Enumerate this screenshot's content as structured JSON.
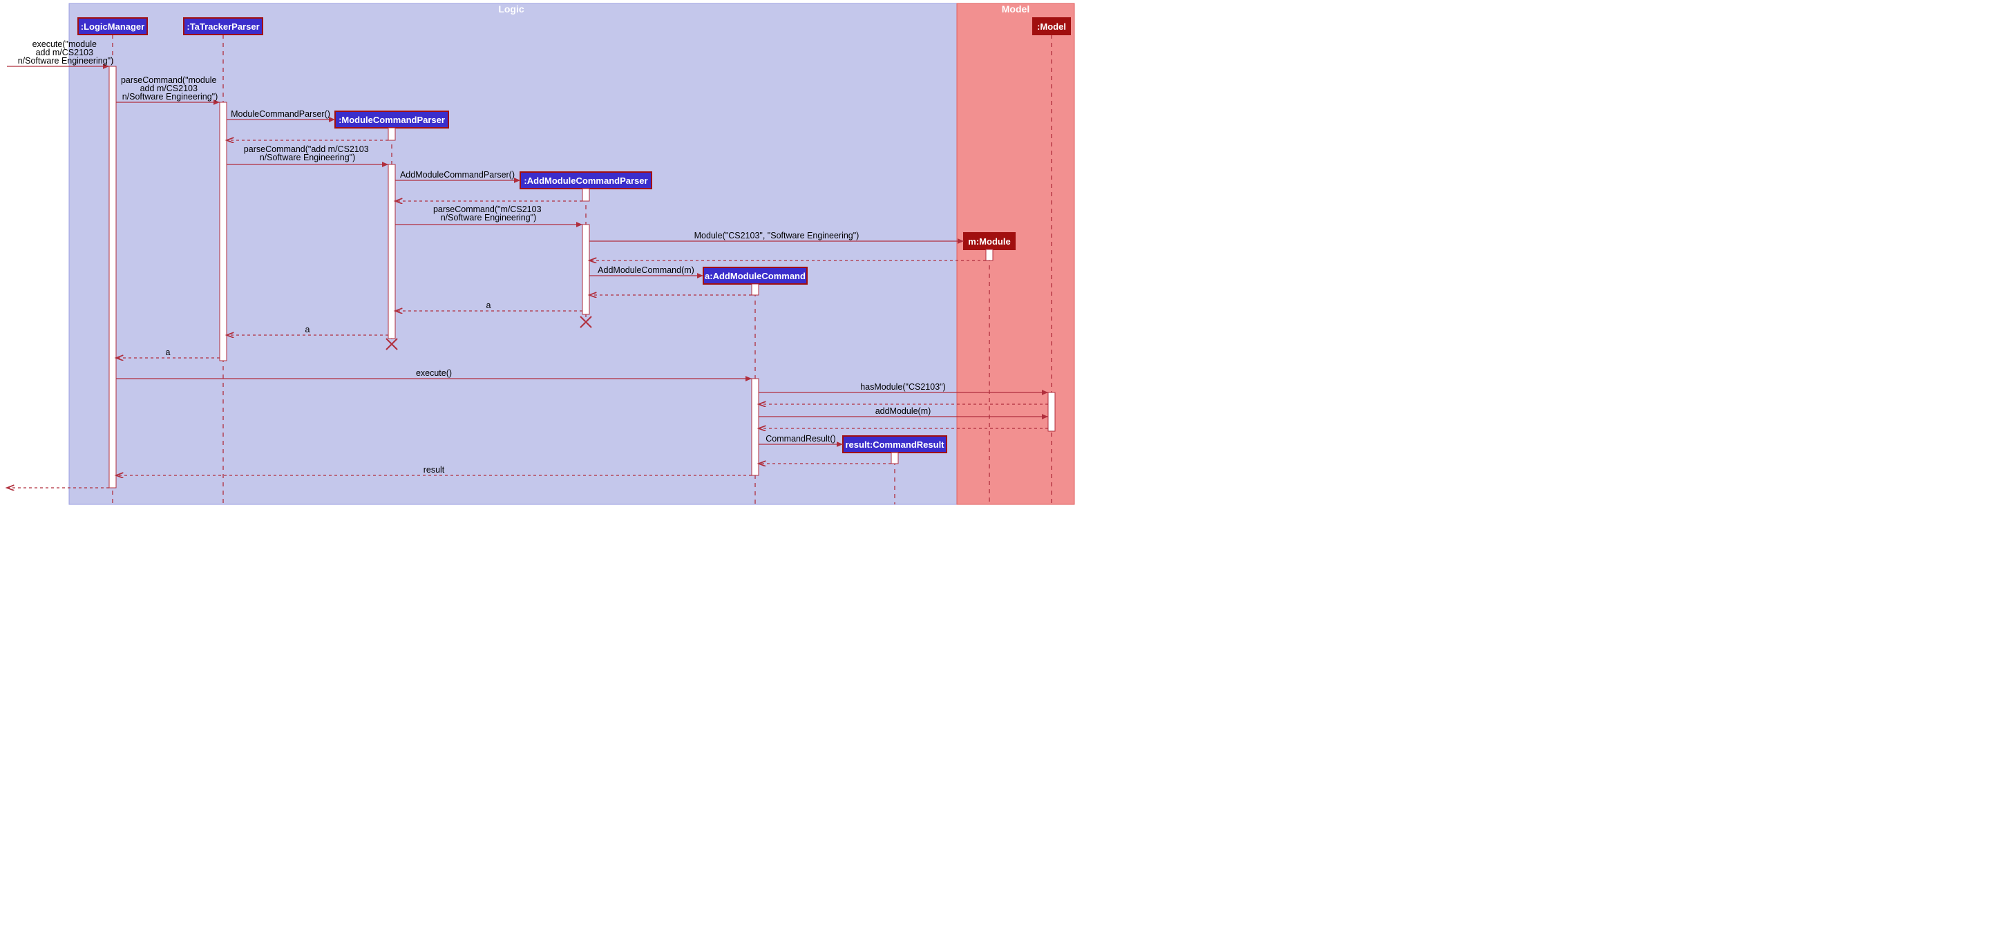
{
  "frames": {
    "logic": {
      "title": "Logic"
    },
    "model": {
      "title": "Model"
    }
  },
  "lifelines": [
    {
      "id": "lm",
      "label": ":LogicManager",
      "kind": "logic"
    },
    {
      "id": "ttp",
      "label": ":TaTrackerParser",
      "kind": "logic"
    },
    {
      "id": "mcp",
      "label": ":ModuleCommandParser",
      "kind": "logic"
    },
    {
      "id": "amcp",
      "label": ":AddModuleCommandParser",
      "kind": "logic"
    },
    {
      "id": "amc",
      "label": "a:AddModuleCommand",
      "kind": "logic"
    },
    {
      "id": "cr",
      "label": "result:CommandResult",
      "kind": "logic"
    },
    {
      "id": "mm",
      "label": "m:Module",
      "kind": "model"
    },
    {
      "id": "mdl",
      "label": ":Model",
      "kind": "model"
    }
  ],
  "messages": {
    "m_exec_in": "execute(\"module\nadd m/CS2103\nn/Software Engineering\")",
    "m_parse1": "parseCommand(\"module\nadd m/CS2103\nn/Software Engineering\")",
    "m_mcp_new": "ModuleCommandParser()",
    "m_parse2": "parseCommand(\"add m/CS2103\nn/Software Engineering\")",
    "m_amcp_new": "AddModuleCommandParser()",
    "m_parse3": "parseCommand(\"m/CS2103\nn/Software Engineering\")",
    "m_module_new": "Module(\"CS2103\", \"Software Engineering\")",
    "m_amc_new": "AddModuleCommand(m)",
    "m_ret_a1": "a",
    "m_ret_a2": "a",
    "m_ret_a3": "a",
    "m_execute": "execute()",
    "m_hasmod": "hasModule(\"CS2103\")",
    "m_addmod": "addModule(m)",
    "m_cr_new": "CommandResult()",
    "m_ret_res": "result"
  }
}
